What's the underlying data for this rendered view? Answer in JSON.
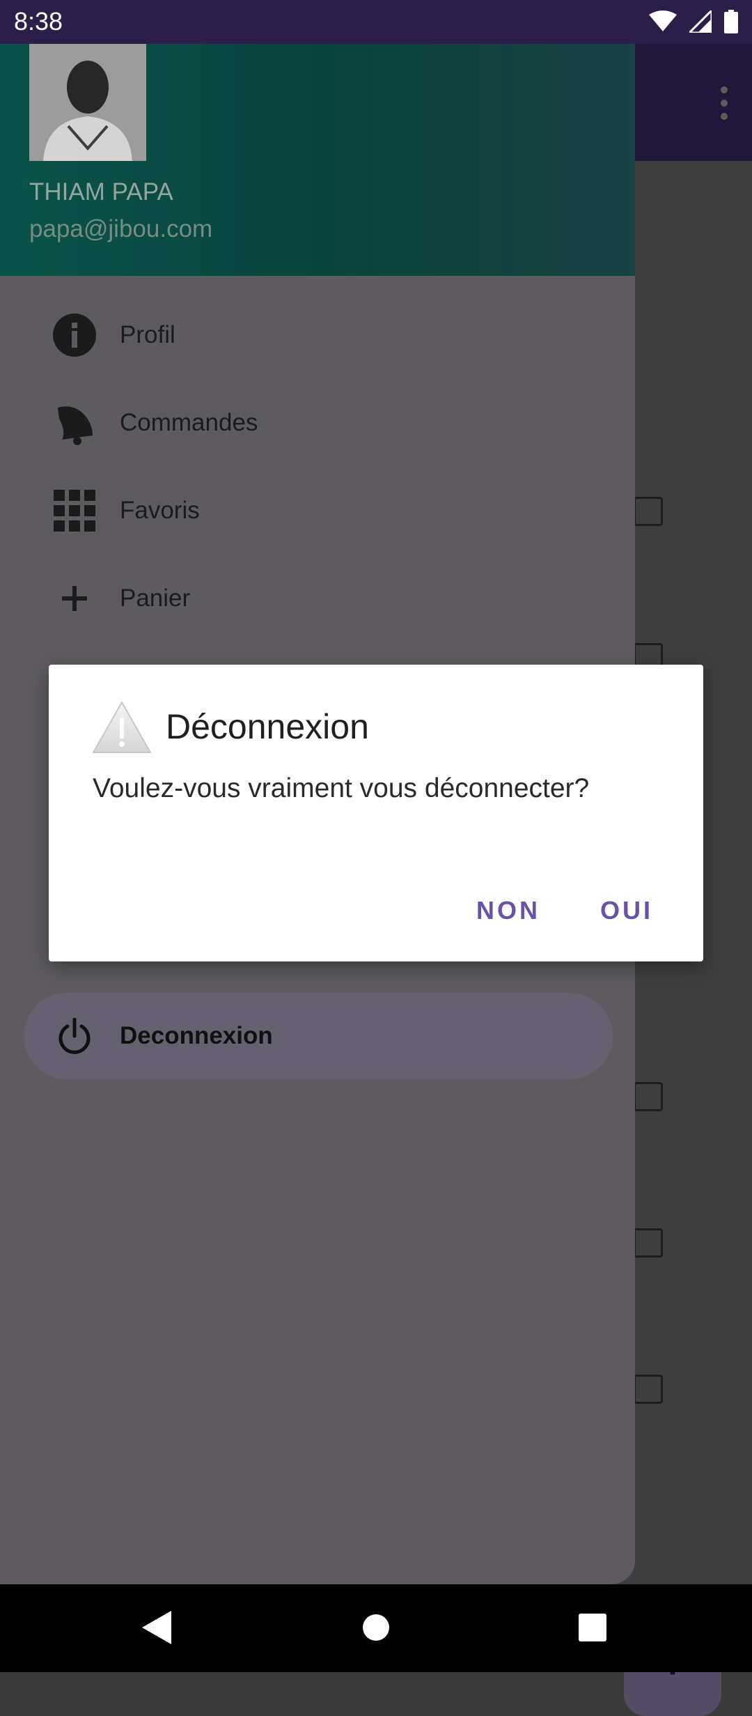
{
  "status_bar": {
    "time": "8:38"
  },
  "drawer": {
    "user_name": "THIAM PAPA",
    "user_email": "papa@jibou.com",
    "items": [
      {
        "label": "Profil",
        "icon": "info-icon"
      },
      {
        "label": "Commandes",
        "icon": "bell-icon"
      },
      {
        "label": "Favoris",
        "icon": "grid-icon"
      },
      {
        "label": "Panier",
        "icon": "plus-icon"
      },
      {
        "label": "Deconnexion",
        "icon": "power-icon",
        "active": true
      }
    ]
  },
  "dialog": {
    "title": "Déconnexion",
    "message": "Voulez-vous vraiment vous déconnecter?",
    "negative_label": "NON",
    "positive_label": "OUI",
    "icon": "warning-icon"
  },
  "fab": {
    "icon": "plus-icon",
    "label": "+"
  },
  "colors": {
    "accent": "#6a52a8",
    "drawer_header": "#0b5a4f",
    "status_bar": "#2b1f4a"
  }
}
